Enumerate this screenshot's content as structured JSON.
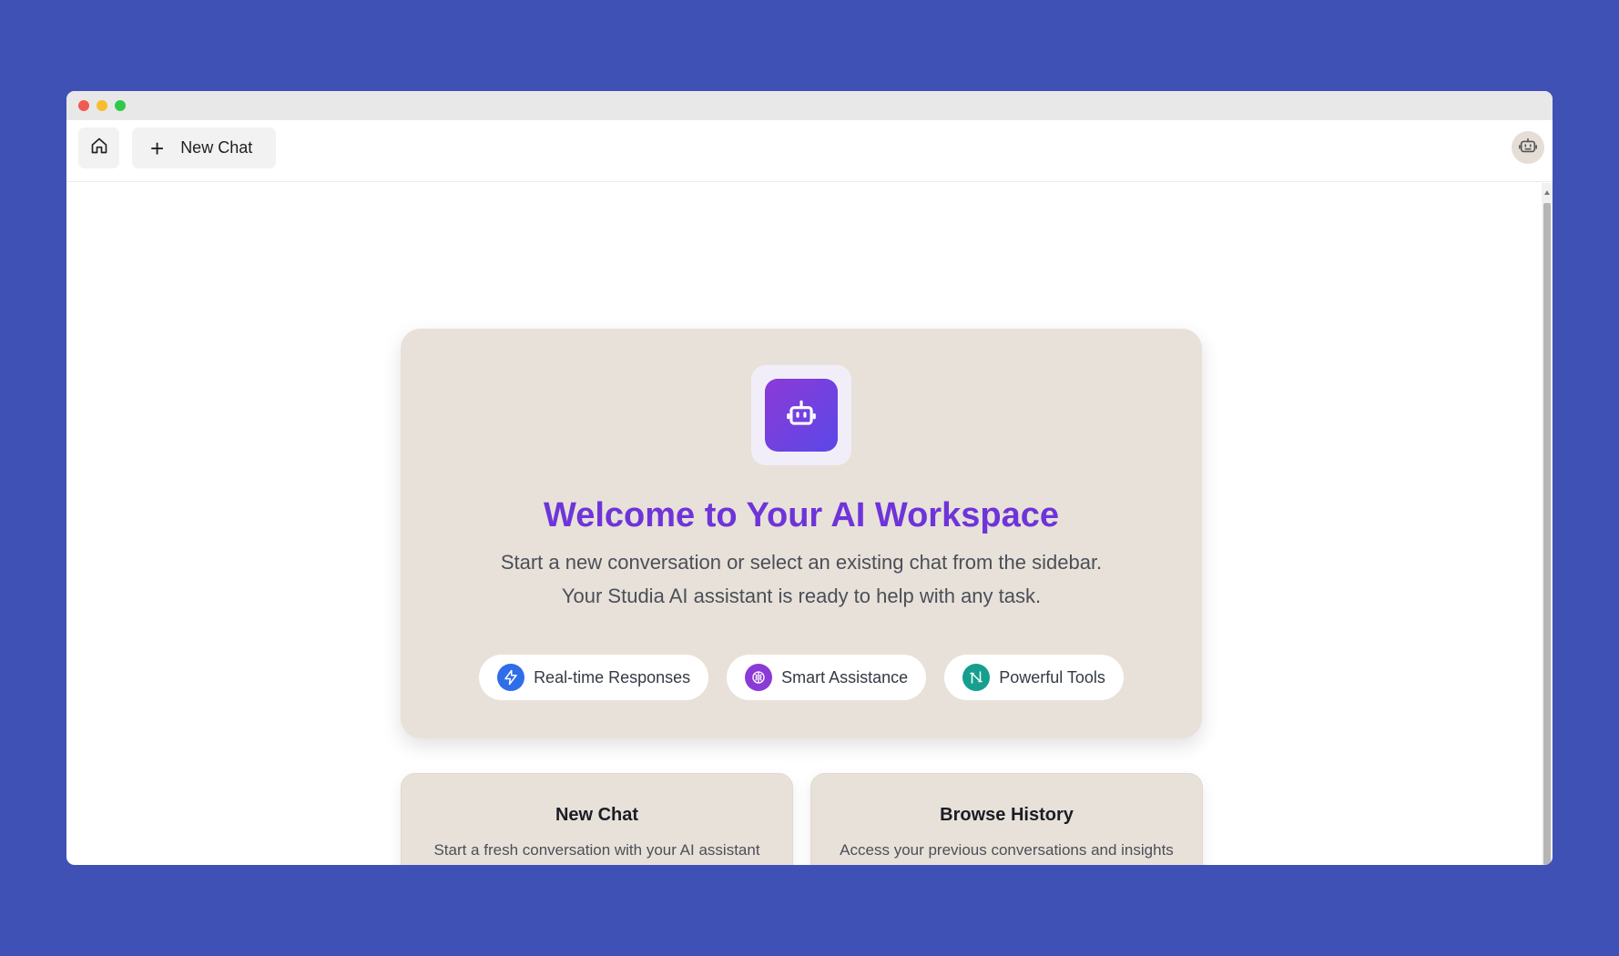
{
  "toolbar": {
    "new_chat_label": "New Chat"
  },
  "hero": {
    "title": "Welcome to Your AI Workspace",
    "subtitle_line1": "Start a new conversation or select an existing chat from the sidebar.",
    "subtitle_line2": "Your Studia AI assistant is ready to help with any task.",
    "features": [
      {
        "label": "Real-time Responses",
        "icon": "lightning-icon",
        "color": "#2f6ee8"
      },
      {
        "label": "Smart Assistance",
        "icon": "brain-icon",
        "color": "#8a3ad6"
      },
      {
        "label": "Powerful Tools",
        "icon": "tools-icon",
        "color": "#169e8e"
      }
    ]
  },
  "cards": [
    {
      "title": "New Chat",
      "description": "Start a fresh conversation with your AI assistant"
    },
    {
      "title": "Browse History",
      "description": "Access your previous conversations and insights"
    }
  ],
  "colors": {
    "background": "#4051b5",
    "accent": "#6e34d9",
    "card_bg": "#e8e1d9"
  }
}
